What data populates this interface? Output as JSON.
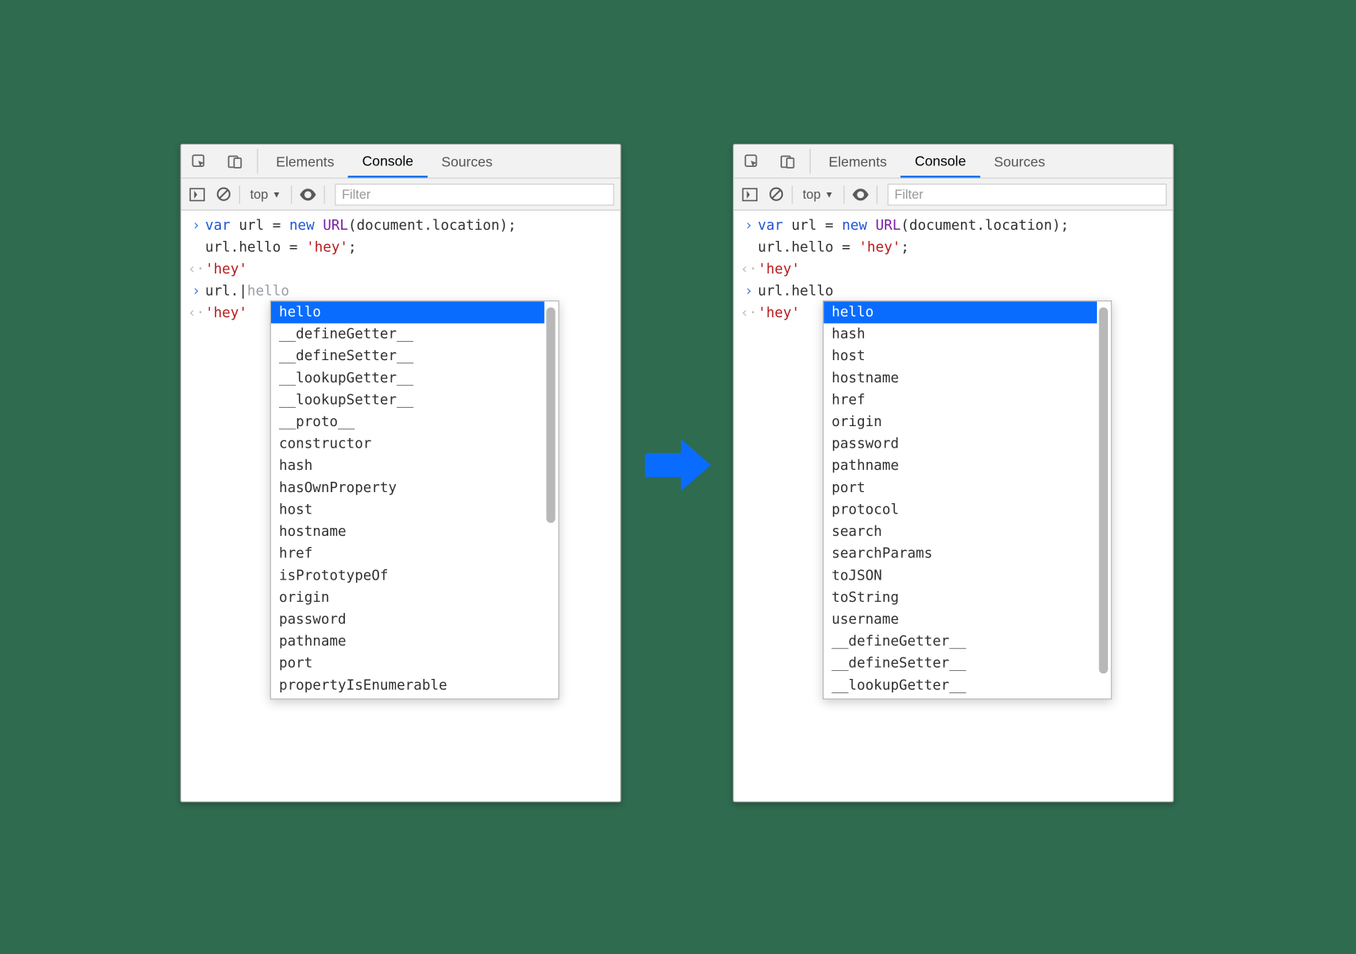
{
  "tabs": {
    "elements": "Elements",
    "console": "Console",
    "sources": "Sources"
  },
  "toolbar": {
    "context": "top",
    "filter_placeholder": "Filter"
  },
  "code": {
    "line1_pre": "var",
    "line1_mid": " url = ",
    "line1_new": "new",
    "line1_sp": " ",
    "line1_cls": "URL",
    "line1_post": "(document.location);",
    "line2": "url.hello = ",
    "line2_str": "'hey'",
    "line2_end": ";",
    "result1": "'hey'",
    "input2_left": "url.",
    "input2_typed_cursor": "|",
    "input2_suffix": "hello",
    "input2_full": "url.hello",
    "result2": "'hey'"
  },
  "ac_left": [
    "hello",
    "__defineGetter__",
    "__defineSetter__",
    "__lookupGetter__",
    "__lookupSetter__",
    "__proto__",
    "constructor",
    "hash",
    "hasOwnProperty",
    "host",
    "hostname",
    "href",
    "isPrototypeOf",
    "origin",
    "password",
    "pathname",
    "port",
    "propertyIsEnumerable"
  ],
  "ac_right": [
    "hello",
    "hash",
    "host",
    "hostname",
    "href",
    "origin",
    "password",
    "pathname",
    "port",
    "protocol",
    "search",
    "searchParams",
    "toJSON",
    "toString",
    "username",
    "__defineGetter__",
    "__defineSetter__",
    "__lookupGetter__"
  ]
}
